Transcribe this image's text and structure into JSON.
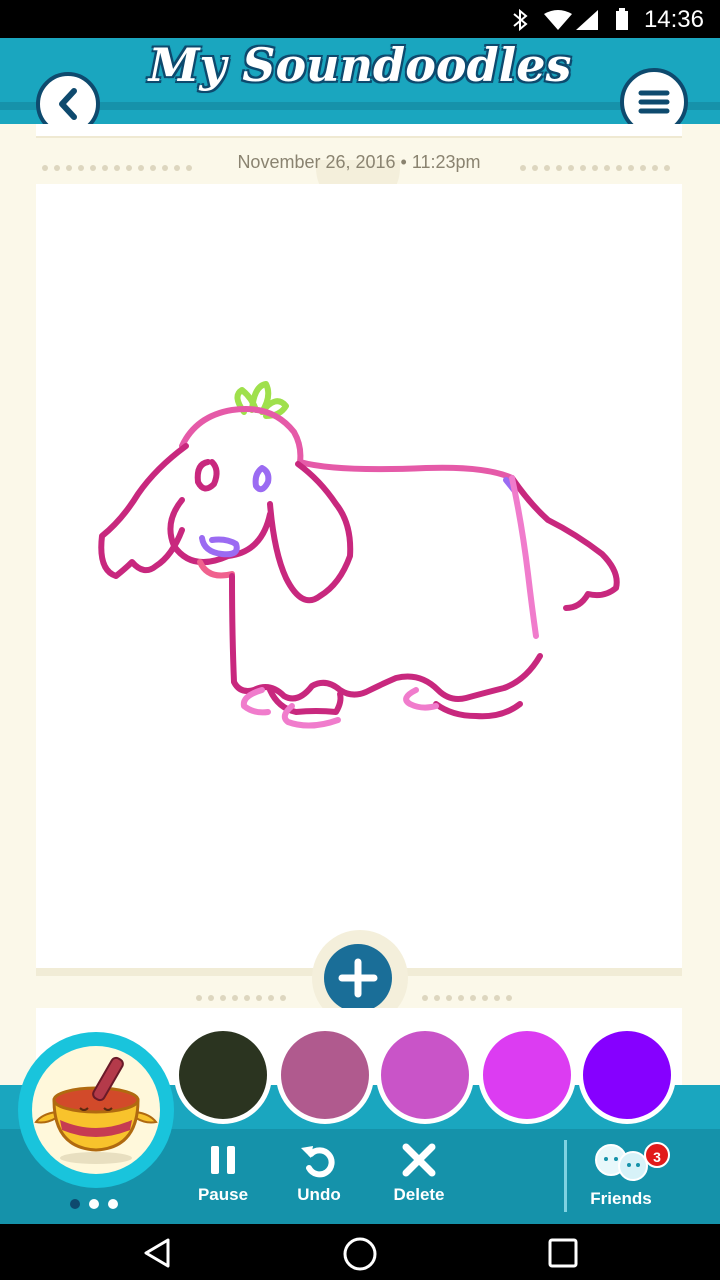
{
  "status_bar": {
    "time": "14:36"
  },
  "header": {
    "title": "My Soundoodles"
  },
  "entry": {
    "date": "November 26, 2016 • 11:23pm"
  },
  "palette": {
    "colors": [
      "#2b3420",
      "#b05a8e",
      "#c954c8",
      "#dc3cf2",
      "#8600ff"
    ]
  },
  "toolbar": {
    "pause_label": "Pause",
    "undo_label": "Undo",
    "delete_label": "Delete",
    "friends_label": "Friends",
    "friends_badge": "3"
  },
  "icons": [
    "back-icon",
    "menu-icon",
    "plus-icon",
    "pause-icon",
    "undo-icon",
    "delete-icon",
    "friends-icon",
    "singing-bowl-icon",
    "nav-back-icon",
    "nav-home-icon",
    "nav-recents-icon"
  ]
}
